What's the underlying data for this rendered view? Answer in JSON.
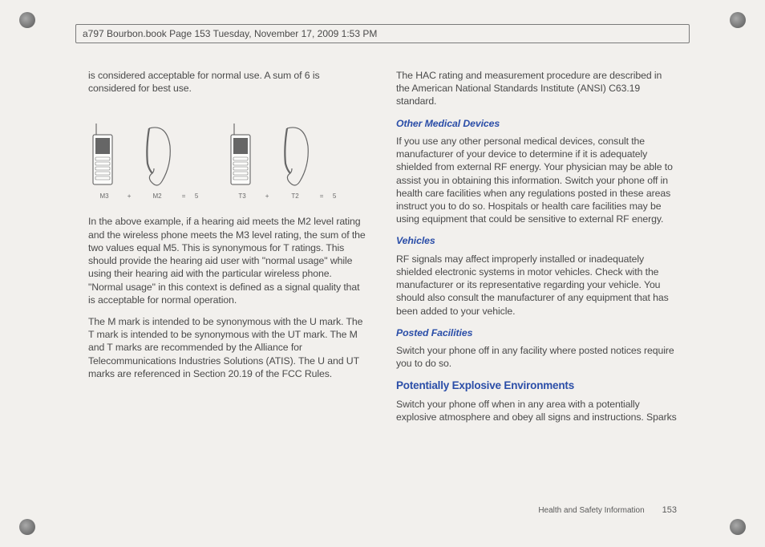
{
  "header": {
    "text": "a797 Bourbon.book  Page 153  Tuesday, November 17, 2009  1:53 PM"
  },
  "left": {
    "p1": "is considered acceptable for normal use. A sum of 6 is considered for best use.",
    "diagram": {
      "label_m3": "M3",
      "plus1": "+",
      "label_m2": "M2",
      "eq1": "=",
      "five1": "5",
      "label_t3": "T3",
      "plus2": "+",
      "label_t2": "T2",
      "eq2": "=",
      "five2": "5"
    },
    "p2": "In the above example, if a hearing aid meets the M2 level rating and the wireless phone meets the M3 level rating, the sum of the two values equal M5. This is synonymous for T ratings. This should provide the hearing aid user with \"normal usage\" while using their hearing aid with the particular wireless phone. \"Normal usage\" in this context is defined as a signal quality that is acceptable for normal operation.",
    "p3": "The M mark is intended to be synonymous with the U mark. The T mark is intended to be synonymous with the UT mark. The M and T marks are recommended by the Alliance for Telecommunications Industries Solutions (ATIS). The U and UT marks are referenced in Section 20.19 of the FCC Rules."
  },
  "right": {
    "p1": "The HAC rating and measurement procedure are described in the American National Standards Institute (ANSI) C63.19 standard.",
    "h_other_med": "Other Medical Devices",
    "p_other_med": "If you use any other personal medical devices, consult the manufacturer of your device to determine if it is adequately shielded from external RF energy. Your physician may be able to assist you in obtaining this information. Switch your phone off in health care facilities when any regulations posted in these areas instruct you to do so. Hospitals or health care facilities may be using equipment that could be sensitive to external RF energy.",
    "h_vehicles": "Vehicles",
    "p_vehicles": "RF signals may affect improperly installed or inadequately shielded electronic systems in motor vehicles. Check with the manufacturer or its representative regarding your vehicle. You should also consult the manufacturer of any equipment that has been added to your vehicle.",
    "h_posted": "Posted Facilities",
    "p_posted": "Switch your phone off in any facility where posted notices require you to do so.",
    "h_explosive": "Potentially Explosive Environments",
    "p_explosive": "Switch your phone off when in any area with a potentially explosive atmosphere and obey all signs and instructions. Sparks"
  },
  "footer": {
    "section": "Health and Safety Information",
    "page": "153"
  }
}
